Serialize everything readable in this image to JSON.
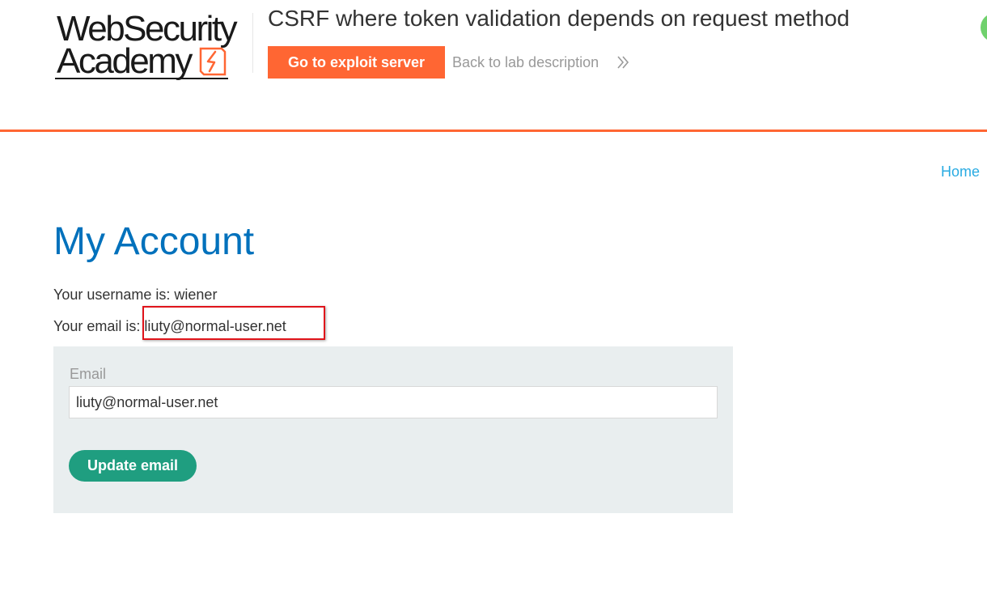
{
  "header": {
    "logo": {
      "line1": "WebSecurity",
      "line2": "Academy"
    },
    "lab_title": "CSRF where token validation depends on request method",
    "exploit_button_label": "Go to exploit server",
    "back_link_label": "Back to lab description"
  },
  "nav": {
    "home_label": "Home"
  },
  "account": {
    "title": "My Account",
    "username_text": "Your username is: wiener",
    "email_text": "Your email is: liuty@normal-user.net"
  },
  "form": {
    "email_label": "Email",
    "email_value": "liuty@normal-user.net",
    "submit_label": "Update email"
  },
  "colors": {
    "accent_orange": "#ff6633",
    "title_blue": "#0071bc",
    "link_blue": "#29abe2",
    "button_green": "#1f9e80",
    "highlight_red": "#e0141b",
    "panel_gray": "#e9eeef"
  }
}
